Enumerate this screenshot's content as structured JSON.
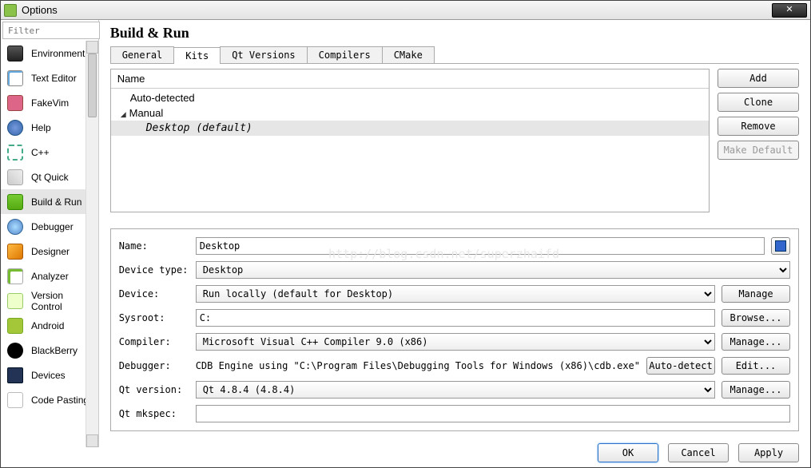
{
  "title": "Options",
  "filter_placeholder": "Filter",
  "sidebar": {
    "items": [
      {
        "label": "Environment"
      },
      {
        "label": "Text Editor"
      },
      {
        "label": "FakeVim"
      },
      {
        "label": "Help"
      },
      {
        "label": "C++"
      },
      {
        "label": "Qt Quick"
      },
      {
        "label": "Build & Run"
      },
      {
        "label": "Debugger"
      },
      {
        "label": "Designer"
      },
      {
        "label": "Analyzer"
      },
      {
        "label": "Version Control"
      },
      {
        "label": "Android"
      },
      {
        "label": "BlackBerry"
      },
      {
        "label": "Devices"
      },
      {
        "label": "Code Pasting"
      }
    ]
  },
  "heading": "Build & Run",
  "tabs": [
    "General",
    "Kits",
    "Qt Versions",
    "Compilers",
    "CMake"
  ],
  "tree": {
    "header": "Name",
    "group1": "Auto-detected",
    "group2": "Manual",
    "leaf": "Desktop (default)"
  },
  "buttons": {
    "add": "Add",
    "clone": "Clone",
    "remove": "Remove",
    "make_default": "Make Default"
  },
  "form": {
    "name_label": "Name:",
    "name_value": "Desktop",
    "device_type_label": "Device type:",
    "device_type_value": "Desktop",
    "device_label": "Device:",
    "device_value": "Run locally (default for Desktop)",
    "device_manage": "Manage",
    "sysroot_label": "Sysroot:",
    "sysroot_value": "C:",
    "sysroot_browse": "Browse...",
    "compiler_label": "Compiler:",
    "compiler_value": "Microsoft Visual C++ Compiler 9.0 (x86)",
    "compiler_manage": "Manage...",
    "debugger_label": "Debugger:",
    "debugger_value": "CDB Engine using \"C:\\Program Files\\Debugging Tools for Windows (x86)\\cdb.exe\"",
    "debugger_auto": "Auto-detect",
    "debugger_edit": "Edit...",
    "qtver_label": "Qt version:",
    "qtver_value": "Qt 4.8.4 (4.8.4)",
    "qtver_manage": "Manage...",
    "mkspec_label": "Qt mkspec:",
    "mkspec_value": ""
  },
  "dialog": {
    "ok": "OK",
    "cancel": "Cancel",
    "apply": "Apply"
  },
  "watermark": "http://blog.csdn.net/superzhaifd"
}
